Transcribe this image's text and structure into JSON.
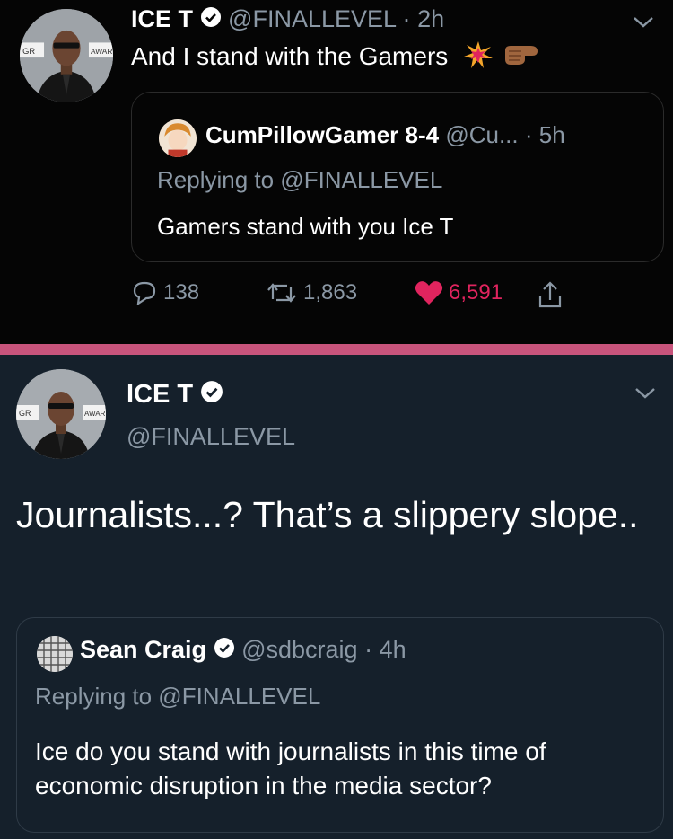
{
  "top_tweet": {
    "author_name": "ICE T",
    "handle": "@FINALLEVEL",
    "separator": "·",
    "time": "2h",
    "text": "And I stand with the Gamers",
    "avatar_badge_left": "GR",
    "avatar_badge_right": "AWAR",
    "quoted": {
      "author_name": "CumPillowGamer 8-4",
      "handle": "@Cu...",
      "separator": "·",
      "time": "5h",
      "reply_to": "Replying to @FINALLEVEL",
      "text": "Gamers stand with you Ice T"
    },
    "actions": {
      "replies": "138",
      "retweets": "1,863",
      "likes": "6,591"
    }
  },
  "bottom_tweet": {
    "author_name": "ICE T",
    "handle": "@FINALLEVEL",
    "text": "Journalists...? That’s a slippery slope..",
    "avatar_badge_left": "GR",
    "avatar_badge_right": "AWAR",
    "quoted": {
      "author_name": "Sean Craig",
      "handle": "@sdbcraig",
      "separator": "·",
      "time": "4h",
      "reply_to": "Replying to @FINALLEVEL",
      "text": "Ice do you stand with journalists in this time of economic disruption in the media sector?"
    }
  },
  "colors": {
    "top_background": "#050505",
    "bottom_background": "#15202b",
    "divider": "#c8547c",
    "muted_text": "#8b98a5",
    "like_red": "#e0245e",
    "verified_white": "#ffffff"
  },
  "icons": [
    "verified-icon",
    "chevron-down-icon",
    "explosion-emoji-icon",
    "pointing-fist-emoji-icon",
    "reply-icon",
    "retweet-icon",
    "heart-icon",
    "share-icon"
  ]
}
